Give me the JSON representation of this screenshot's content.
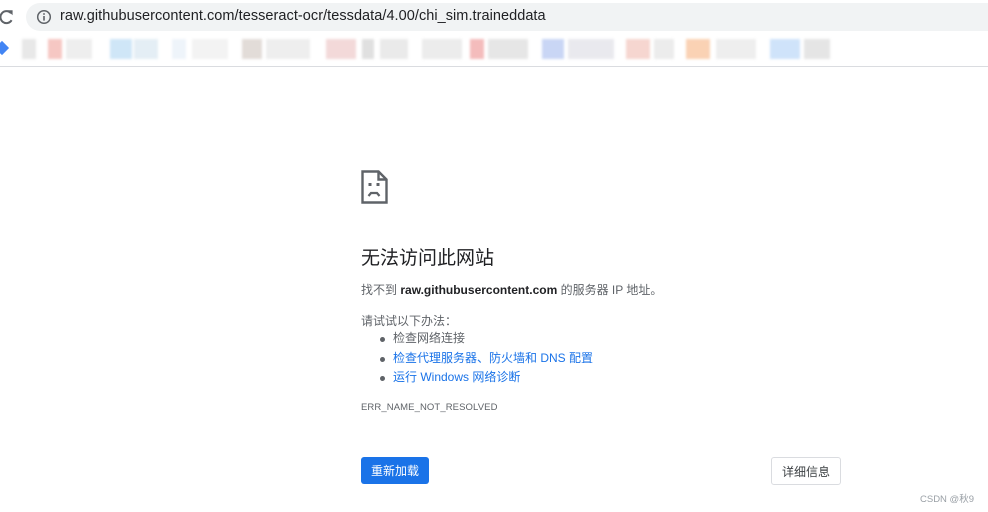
{
  "toolbar": {
    "reload_icon": "reload-icon",
    "info_icon": "info-icon",
    "url": "raw.githubusercontent.com/tesseract-ocr/tessdata/4.00/chi_sim.traineddata"
  },
  "error_page": {
    "icon": "sad-document-icon",
    "heading": "无法访问此网站",
    "desc_prefix": "找不到 ",
    "desc_host": "raw.githubusercontent.com",
    "desc_suffix": " 的服务器 IP 地址。",
    "suggestions_intro": "请试试以下办法：",
    "suggestions": [
      {
        "label": "检查网络连接",
        "link": false
      },
      {
        "label": "检查代理服务器、防火墙和 DNS 配置",
        "link": true
      },
      {
        "label": "运行 Windows 网络诊断",
        "link": true
      }
    ],
    "error_code": "ERR_NAME_NOT_RESOLVED",
    "reload_label": "重新加载",
    "details_label": "详细信息"
  },
  "colors": {
    "accent": "#1a73e8",
    "text_primary": "#202124",
    "text_secondary": "#5f6368",
    "omnibox_bg": "#f1f3f4"
  },
  "watermark": "CSDN @秋9"
}
